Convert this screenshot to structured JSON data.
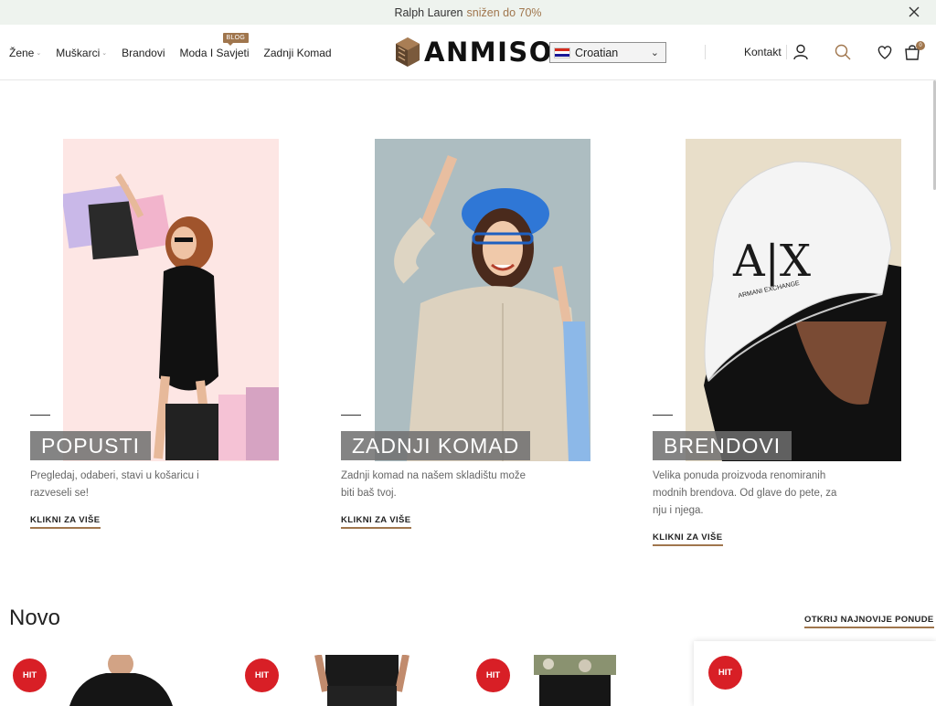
{
  "promo": {
    "brand": "Ralph Lauren",
    "sale_text": "snižen do 70%"
  },
  "nav": {
    "items": [
      {
        "label": "Žene",
        "has_caret": true
      },
      {
        "label": "Muškarci",
        "has_caret": true
      },
      {
        "label": "Brandovi",
        "has_caret": false
      },
      {
        "label": "Moda I Savjeti",
        "has_caret": false,
        "badge": "BLOG"
      },
      {
        "label": "Zadnji Komad",
        "has_caret": false
      }
    ]
  },
  "logo": {
    "text": "ANMISO"
  },
  "language": {
    "selected": "Croatian"
  },
  "header": {
    "contact_label": "Kontakt",
    "cart_count": "0"
  },
  "cards": [
    {
      "title": "POPUSTI",
      "description": "Pregledaj, odaberi, stavi u košaricu i razveseli se!",
      "link": "KLIKNI ZA VIŠE"
    },
    {
      "title": "ZADNJI KOMAD",
      "description": "Zadnji komad na našem skladištu može biti baš tvoj.",
      "link": "KLIKNI ZA VIŠE"
    },
    {
      "title": "BRENDOVI",
      "description": "Velika ponuda proizvoda renomiranih modnih brendova. Od glave do pete, za nju i njega.",
      "link": "KLIKNI ZA VIŠE"
    }
  ],
  "new_section": {
    "title": "Novo",
    "link": "OTKRIJ NAJNOVIJE PONUDE",
    "badge": "HIT"
  },
  "hat_text": {
    "logo": "A|X",
    "line": "ARMANI EXCHANGE"
  },
  "colors": {
    "accent": "#a0764d",
    "hit": "#d81f26",
    "promo_bg": "#eef3ee"
  }
}
